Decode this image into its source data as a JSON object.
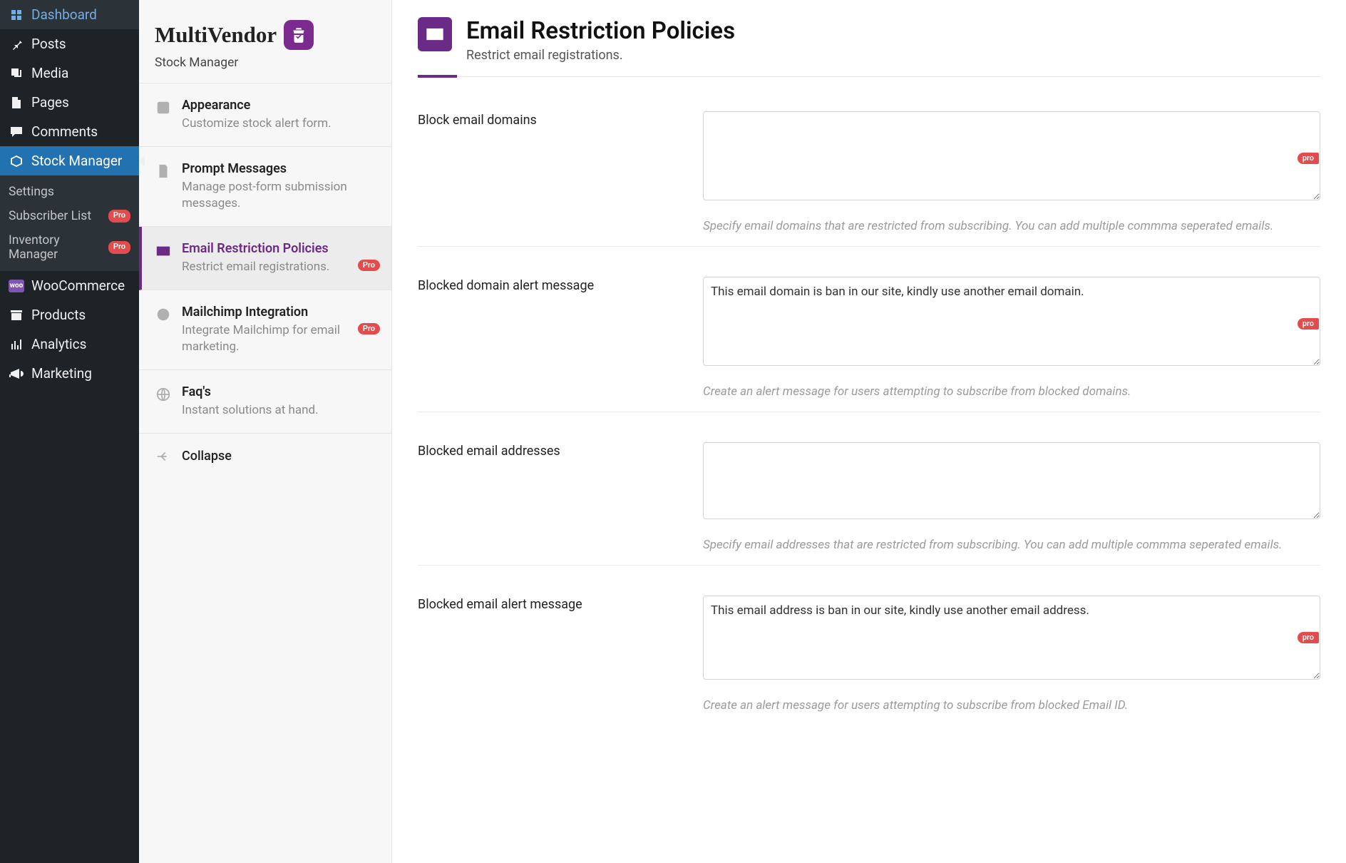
{
  "wp_menu": {
    "dashboard": "Dashboard",
    "posts": "Posts",
    "media": "Media",
    "pages": "Pages",
    "comments": "Comments",
    "stock_manager": "Stock Manager",
    "woocommerce": "WooCommerce",
    "products": "Products",
    "analytics": "Analytics",
    "marketing": "Marketing"
  },
  "wp_submenu": {
    "settings": "Settings",
    "subscriber_list": "Subscriber List",
    "inventory_manager": "Inventory Manager"
  },
  "pro_label": "Pro",
  "pro_small": "pro",
  "brand": {
    "name": "MultiVendor",
    "subtitle": "Stock Manager"
  },
  "settings_tabs": {
    "appearance": {
      "title": "Appearance",
      "desc": "Customize stock alert form."
    },
    "prompt": {
      "title": "Prompt Messages",
      "desc": "Manage post-form submission messages."
    },
    "email_restriction": {
      "title": "Email Restriction Policies",
      "desc": "Restrict email registrations."
    },
    "mailchimp": {
      "title": "Mailchimp Integration",
      "desc": "Integrate Mailchimp for email marketing."
    },
    "faqs": {
      "title": "Faq's",
      "desc": "Instant solutions at hand."
    },
    "collapse": "Collapse"
  },
  "page": {
    "title": "Email Restriction Policies",
    "subtitle": "Restrict email registrations."
  },
  "form": {
    "block_domains": {
      "label": "Block email domains",
      "value": "",
      "help": "Specify email domains that are restricted from subscribing. You can add multiple commma seperated emails."
    },
    "blocked_domain_msg": {
      "label": "Blocked domain alert message",
      "value": "This email domain is ban in our site, kindly use another email domain.",
      "help": "Create an alert message for users attempting to subscribe from blocked domains."
    },
    "blocked_addresses": {
      "label": "Blocked email addresses",
      "value": "",
      "help": "Specify email addresses that are restricted from subscribing. You can add multiple commma seperated emails."
    },
    "blocked_email_msg": {
      "label": "Blocked email alert message",
      "value": "This email address is ban in our site, kindly use another email address.",
      "help": "Create an alert message for users attempting to subscribe from blocked Email ID."
    }
  }
}
